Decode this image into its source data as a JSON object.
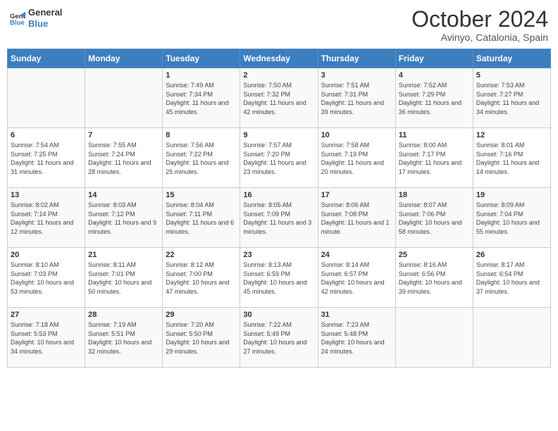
{
  "header": {
    "logo_text_top": "General",
    "logo_text_bottom": "Blue",
    "month_year": "October 2024",
    "location": "Avinyo, Catalonia, Spain"
  },
  "weekdays": [
    "Sunday",
    "Monday",
    "Tuesday",
    "Wednesday",
    "Thursday",
    "Friday",
    "Saturday"
  ],
  "weeks": [
    [
      {
        "day": "",
        "sunrise": "",
        "sunset": "",
        "daylight": ""
      },
      {
        "day": "",
        "sunrise": "",
        "sunset": "",
        "daylight": ""
      },
      {
        "day": "1",
        "sunrise": "Sunrise: 7:49 AM",
        "sunset": "Sunset: 7:34 PM",
        "daylight": "Daylight: 11 hours and 45 minutes."
      },
      {
        "day": "2",
        "sunrise": "Sunrise: 7:50 AM",
        "sunset": "Sunset: 7:32 PM",
        "daylight": "Daylight: 11 hours and 42 minutes."
      },
      {
        "day": "3",
        "sunrise": "Sunrise: 7:51 AM",
        "sunset": "Sunset: 7:31 PM",
        "daylight": "Daylight: 11 hours and 39 minutes."
      },
      {
        "day": "4",
        "sunrise": "Sunrise: 7:52 AM",
        "sunset": "Sunset: 7:29 PM",
        "daylight": "Daylight: 11 hours and 36 minutes."
      },
      {
        "day": "5",
        "sunrise": "Sunrise: 7:53 AM",
        "sunset": "Sunset: 7:27 PM",
        "daylight": "Daylight: 11 hours and 34 minutes."
      }
    ],
    [
      {
        "day": "6",
        "sunrise": "Sunrise: 7:54 AM",
        "sunset": "Sunset: 7:25 PM",
        "daylight": "Daylight: 11 hours and 31 minutes."
      },
      {
        "day": "7",
        "sunrise": "Sunrise: 7:55 AM",
        "sunset": "Sunset: 7:24 PM",
        "daylight": "Daylight: 11 hours and 28 minutes."
      },
      {
        "day": "8",
        "sunrise": "Sunrise: 7:56 AM",
        "sunset": "Sunset: 7:22 PM",
        "daylight": "Daylight: 11 hours and 25 minutes."
      },
      {
        "day": "9",
        "sunrise": "Sunrise: 7:57 AM",
        "sunset": "Sunset: 7:20 PM",
        "daylight": "Daylight: 11 hours and 23 minutes."
      },
      {
        "day": "10",
        "sunrise": "Sunrise: 7:58 AM",
        "sunset": "Sunset: 7:19 PM",
        "daylight": "Daylight: 11 hours and 20 minutes."
      },
      {
        "day": "11",
        "sunrise": "Sunrise: 8:00 AM",
        "sunset": "Sunset: 7:17 PM",
        "daylight": "Daylight: 11 hours and 17 minutes."
      },
      {
        "day": "12",
        "sunrise": "Sunrise: 8:01 AM",
        "sunset": "Sunset: 7:16 PM",
        "daylight": "Daylight: 11 hours and 14 minutes."
      }
    ],
    [
      {
        "day": "13",
        "sunrise": "Sunrise: 8:02 AM",
        "sunset": "Sunset: 7:14 PM",
        "daylight": "Daylight: 11 hours and 12 minutes."
      },
      {
        "day": "14",
        "sunrise": "Sunrise: 8:03 AM",
        "sunset": "Sunset: 7:12 PM",
        "daylight": "Daylight: 11 hours and 9 minutes."
      },
      {
        "day": "15",
        "sunrise": "Sunrise: 8:04 AM",
        "sunset": "Sunset: 7:11 PM",
        "daylight": "Daylight: 11 hours and 6 minutes."
      },
      {
        "day": "16",
        "sunrise": "Sunrise: 8:05 AM",
        "sunset": "Sunset: 7:09 PM",
        "daylight": "Daylight: 11 hours and 3 minutes."
      },
      {
        "day": "17",
        "sunrise": "Sunrise: 8:06 AM",
        "sunset": "Sunset: 7:08 PM",
        "daylight": "Daylight: 11 hours and 1 minute."
      },
      {
        "day": "18",
        "sunrise": "Sunrise: 8:07 AM",
        "sunset": "Sunset: 7:06 PM",
        "daylight": "Daylight: 10 hours and 58 minutes."
      },
      {
        "day": "19",
        "sunrise": "Sunrise: 8:09 AM",
        "sunset": "Sunset: 7:04 PM",
        "daylight": "Daylight: 10 hours and 55 minutes."
      }
    ],
    [
      {
        "day": "20",
        "sunrise": "Sunrise: 8:10 AM",
        "sunset": "Sunset: 7:03 PM",
        "daylight": "Daylight: 10 hours and 53 minutes."
      },
      {
        "day": "21",
        "sunrise": "Sunrise: 8:11 AM",
        "sunset": "Sunset: 7:01 PM",
        "daylight": "Daylight: 10 hours and 50 minutes."
      },
      {
        "day": "22",
        "sunrise": "Sunrise: 8:12 AM",
        "sunset": "Sunset: 7:00 PM",
        "daylight": "Daylight: 10 hours and 47 minutes."
      },
      {
        "day": "23",
        "sunrise": "Sunrise: 8:13 AM",
        "sunset": "Sunset: 6:59 PM",
        "daylight": "Daylight: 10 hours and 45 minutes."
      },
      {
        "day": "24",
        "sunrise": "Sunrise: 8:14 AM",
        "sunset": "Sunset: 6:57 PM",
        "daylight": "Daylight: 10 hours and 42 minutes."
      },
      {
        "day": "25",
        "sunrise": "Sunrise: 8:16 AM",
        "sunset": "Sunset: 6:56 PM",
        "daylight": "Daylight: 10 hours and 39 minutes."
      },
      {
        "day": "26",
        "sunrise": "Sunrise: 8:17 AM",
        "sunset": "Sunset: 6:54 PM",
        "daylight": "Daylight: 10 hours and 37 minutes."
      }
    ],
    [
      {
        "day": "27",
        "sunrise": "Sunrise: 7:18 AM",
        "sunset": "Sunset: 5:53 PM",
        "daylight": "Daylight: 10 hours and 34 minutes."
      },
      {
        "day": "28",
        "sunrise": "Sunrise: 7:19 AM",
        "sunset": "Sunset: 5:51 PM",
        "daylight": "Daylight: 10 hours and 32 minutes."
      },
      {
        "day": "29",
        "sunrise": "Sunrise: 7:20 AM",
        "sunset": "Sunset: 5:50 PM",
        "daylight": "Daylight: 10 hours and 29 minutes."
      },
      {
        "day": "30",
        "sunrise": "Sunrise: 7:22 AM",
        "sunset": "Sunset: 5:49 PM",
        "daylight": "Daylight: 10 hours and 27 minutes."
      },
      {
        "day": "31",
        "sunrise": "Sunrise: 7:23 AM",
        "sunset": "Sunset: 5:48 PM",
        "daylight": "Daylight: 10 hours and 24 minutes."
      },
      {
        "day": "",
        "sunrise": "",
        "sunset": "",
        "daylight": ""
      },
      {
        "day": "",
        "sunrise": "",
        "sunset": "",
        "daylight": ""
      }
    ]
  ]
}
